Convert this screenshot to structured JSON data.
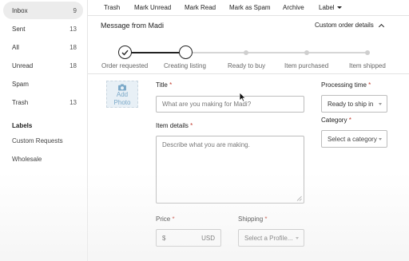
{
  "sidebar": {
    "folders": [
      {
        "label": "Inbox",
        "count": "9"
      },
      {
        "label": "Sent",
        "count": "13"
      },
      {
        "label": "All",
        "count": "18"
      },
      {
        "label": "Unread",
        "count": "18"
      },
      {
        "label": "Spam",
        "count": ""
      },
      {
        "label": "Trash",
        "count": "13"
      }
    ],
    "labels_heading": "Labels",
    "labels": [
      "Custom Requests",
      "Wholesale"
    ]
  },
  "toolbar": {
    "trash": "Trash",
    "mark_unread": "Mark Unread",
    "mark_read": "Mark Read",
    "mark_spam": "Mark as Spam",
    "archive": "Archive",
    "label": "Label"
  },
  "message": {
    "title": "Message from Madi",
    "custom_order_toggle": "Custom order details"
  },
  "progress": {
    "steps": [
      "Order requested",
      "Creating listing",
      "Ready to buy",
      "Item purchased",
      "Item shipped"
    ],
    "completed": 1,
    "current": 2
  },
  "form": {
    "add_photo": "Add Photo",
    "title_label": "Title",
    "title_placeholder": "What are you making for Madi?",
    "details_label": "Item details",
    "details_placeholder": "Describe what you are making.",
    "processing_label": "Processing time",
    "processing_value": "Ready to ship in",
    "category_label": "Category",
    "category_value": "Select a category",
    "price_label": "Price",
    "price_currency_symbol": "$",
    "price_currency_code": "USD",
    "shipping_label": "Shipping",
    "shipping_value": "Select a Profile..."
  },
  "colors": {
    "required_asterisk": "#c0392b",
    "photo_box": "#e8f0f6",
    "progress_done": "#222222",
    "progress_pending": "#cfcfcf"
  }
}
